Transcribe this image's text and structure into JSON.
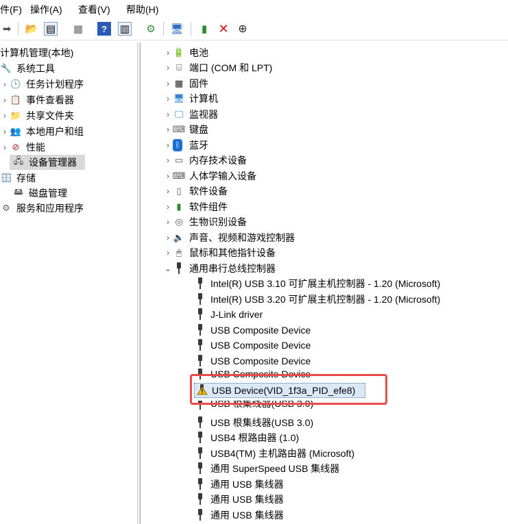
{
  "menubar": {
    "file": "件(F)",
    "action": "操作(A)",
    "view": "查看(V)",
    "help": "帮助(H)"
  },
  "left_tree": {
    "root": "计算机管理(本地)",
    "system_tools": "系统工具",
    "items": [
      "任务计划程序",
      "事件查看器",
      "共享文件夹",
      "本地用户和组",
      "性能",
      "设备管理器"
    ],
    "storage": "存储",
    "disk_mgmt": "磁盘管理",
    "services": "服务和应用程序"
  },
  "categories": [
    "电池",
    "端口 (COM 和 LPT)",
    "固件",
    "计算机",
    "监视器",
    "键盘",
    "蓝牙",
    "内存技术设备",
    "人体学输入设备",
    "软件设备",
    "软件组件",
    "生物识别设备",
    "声音、视频和游戏控制器",
    "鼠标和其他指针设备",
    "通用串行总线控制器"
  ],
  "usb_devices": [
    "Intel(R) USB 3.10 可扩展主机控制器 - 1.20 (Microsoft)",
    "Intel(R) USB 3.20 可扩展主机控制器 - 1.20 (Microsoft)",
    "J-Link driver",
    "USB Composite Device",
    "USB Composite Device",
    "USB Composite Device",
    "USB Composite Device",
    "USB Device(VID_1f3a_PID_efe8)",
    "USB 根集线器(USB 3.0)",
    "USB 根集线器(USB 3.0)",
    "USB4 根路由器 (1.0)",
    "USB4(TM) 主机路由器 (Microsoft)",
    "通用 SuperSpeed USB 集线器",
    "通用 USB 集线器",
    "通用 USB 集线器",
    "通用 USB 集线器"
  ],
  "colors": {
    "highlight": "#ea4a4a",
    "selection": "#dbe8f6",
    "warning": "#f2c200"
  }
}
